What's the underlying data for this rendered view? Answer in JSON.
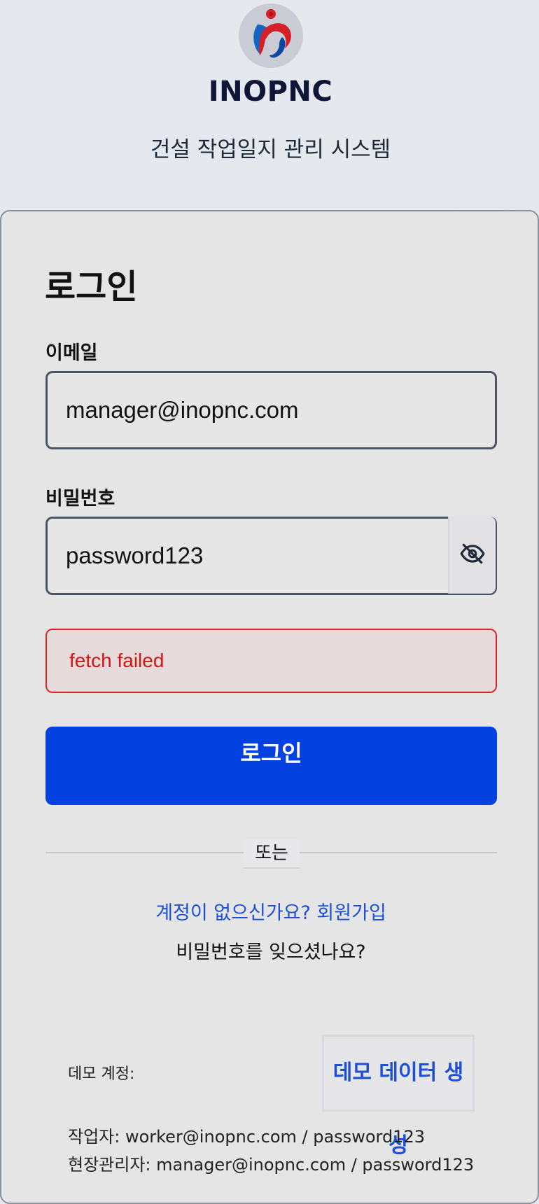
{
  "header": {
    "brand": "INOPNC",
    "subtitle": "건설 작업일지 관리 시스템"
  },
  "login": {
    "title": "로그인",
    "email_label": "이메일",
    "email_value": "manager@inopnc.com",
    "password_label": "비밀번호",
    "password_value": "password123",
    "error_message": "fetch failed",
    "submit_label": "로그인",
    "divider_text": "또는",
    "signup_link": "계정이 없으신가요? 회원가입",
    "forgot_link": "비밀번호를 잊으셨나요?"
  },
  "demo": {
    "label": "데모 계정:",
    "generate_button": "데모 데이터 생성",
    "accounts": [
      "작업자: worker@inopnc.com / password123",
      "현장관리자: manager@inopnc.com / password123"
    ]
  },
  "icons": {
    "logo": "inopnc-logo-icon",
    "password_toggle": "eye-off-icon"
  },
  "colors": {
    "primary": "#0341e0",
    "error": "#d31515",
    "link": "#1d4ed8"
  }
}
